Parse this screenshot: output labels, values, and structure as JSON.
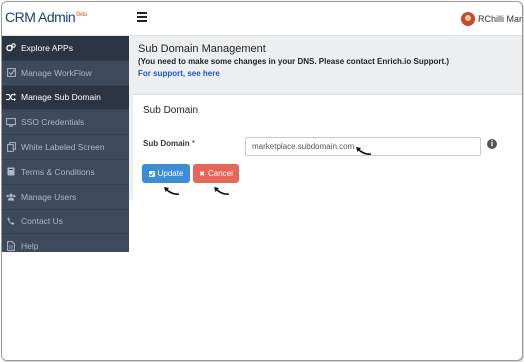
{
  "header": {
    "brand": "CRM Admin",
    "brand_badge": "Beta",
    "user_name": "RChilli Marke"
  },
  "sidebar": {
    "items": [
      {
        "label": "Explore APPs",
        "icon": "cogs-icon"
      },
      {
        "label": "Manage WorkFlow",
        "icon": "checkbox-icon"
      },
      {
        "label": "Manage Sub Domain",
        "icon": "shuffle-icon"
      },
      {
        "label": "SSO Credentials",
        "icon": "desktop-icon"
      },
      {
        "label": "White Labeled Screen",
        "icon": "copy-icon"
      },
      {
        "label": "Terms & Conditions",
        "icon": "book-icon"
      },
      {
        "label": "Manage Users",
        "icon": "users-icon"
      },
      {
        "label": "Contact Us",
        "icon": "phone-icon"
      },
      {
        "label": "Help",
        "icon": "file-icon"
      }
    ]
  },
  "main": {
    "title": "Sub Domain Management",
    "notice": "(You need to make some changes in your DNS. Please contact Enrich.io Support.)",
    "support_link": "For support, see here",
    "card_title": "Sub Domain",
    "field_label": "Sub Domain",
    "field_required": "*",
    "field_value": "marketplace.subdomain.com",
    "update_label": "Update",
    "cancel_label": "Cancel"
  },
  "colors": {
    "sidebar_bg": "#3d4a5c",
    "sidebar_active": "#2a3443",
    "update_button": "#3c8dd6",
    "cancel_button": "#e8655a",
    "link": "#1a55c8"
  }
}
